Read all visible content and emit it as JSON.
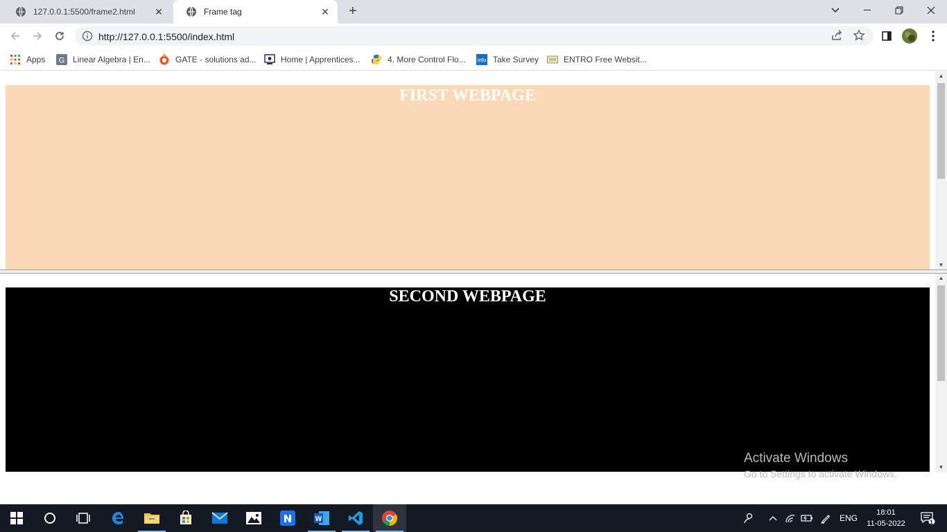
{
  "browser": {
    "tabs": [
      {
        "title": "127.0.0.1:5500/frame2.html",
        "active": false
      },
      {
        "title": "Frame tag",
        "active": true
      }
    ],
    "new_tab_label": "+",
    "address": "http://127.0.0.1:5500/index.html",
    "bookmarks": [
      {
        "label": "Apps",
        "icon": "apps-grid-icon"
      },
      {
        "label": "Linear Algebra | En...",
        "icon": "g-favicon-icon"
      },
      {
        "label": "GATE - solutions ad...",
        "icon": "gate-favicon-icon"
      },
      {
        "label": "Home | Apprentices...",
        "icon": "apprentice-favicon-icon"
      },
      {
        "label": "4. More Control Flo...",
        "icon": "python-favicon-icon"
      },
      {
        "label": "Take Survey",
        "icon": "info-favicon-icon"
      },
      {
        "label": "ENTRO Free Websit...",
        "icon": "entro-favicon-icon"
      }
    ]
  },
  "page": {
    "frame1_heading": "FIRST WEBPAGE",
    "frame1_bg": "#fcd9b6",
    "frame2_heading": "SECOND WEBPAGE",
    "frame2_bg": "#000000"
  },
  "watermark": {
    "line1": "Activate Windows",
    "line2": "Go to Settings to activate Windows."
  },
  "taskbar": {
    "language": "ENG",
    "time": "18:01",
    "date": "11-05-2022",
    "notification_count": "1"
  }
}
